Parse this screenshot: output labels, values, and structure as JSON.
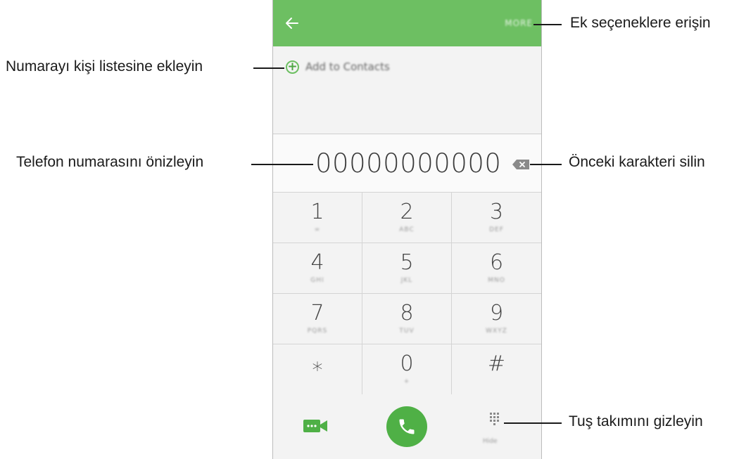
{
  "dialer": {
    "more_label": "MORE",
    "add_to_contacts": "Add to Contacts",
    "number": "00000000000",
    "keys": [
      {
        "digit": "1",
        "letters": "∞"
      },
      {
        "digit": "2",
        "letters": "ABC"
      },
      {
        "digit": "3",
        "letters": "DEF"
      },
      {
        "digit": "4",
        "letters": "GHI"
      },
      {
        "digit": "5",
        "letters": "JKL"
      },
      {
        "digit": "6",
        "letters": "MNO"
      },
      {
        "digit": "7",
        "letters": "PQRS"
      },
      {
        "digit": "8",
        "letters": "TUV"
      },
      {
        "digit": "9",
        "letters": "WXYZ"
      },
      {
        "digit": "⁎",
        "letters": ""
      },
      {
        "digit": "0",
        "letters": "+"
      },
      {
        "digit": "#",
        "letters": ""
      }
    ],
    "hide_label": "Hide",
    "accent_color": "#6dbf62"
  },
  "callouts": {
    "more_options": "Ek seçeneklere erişin",
    "add_contact": "Numarayı kişi listesine ekleyin",
    "preview_number": "Telefon numarasını önizleyin",
    "delete_char": "Önceki karakteri silin",
    "hide_keypad": "Tuş takımını gizleyin"
  },
  "icons": {
    "back": "back-arrow-icon",
    "add": "plus-circle-icon",
    "backspace": "backspace-icon",
    "video": "video-call-icon",
    "call": "phone-icon",
    "keypad": "keypad-icon"
  }
}
